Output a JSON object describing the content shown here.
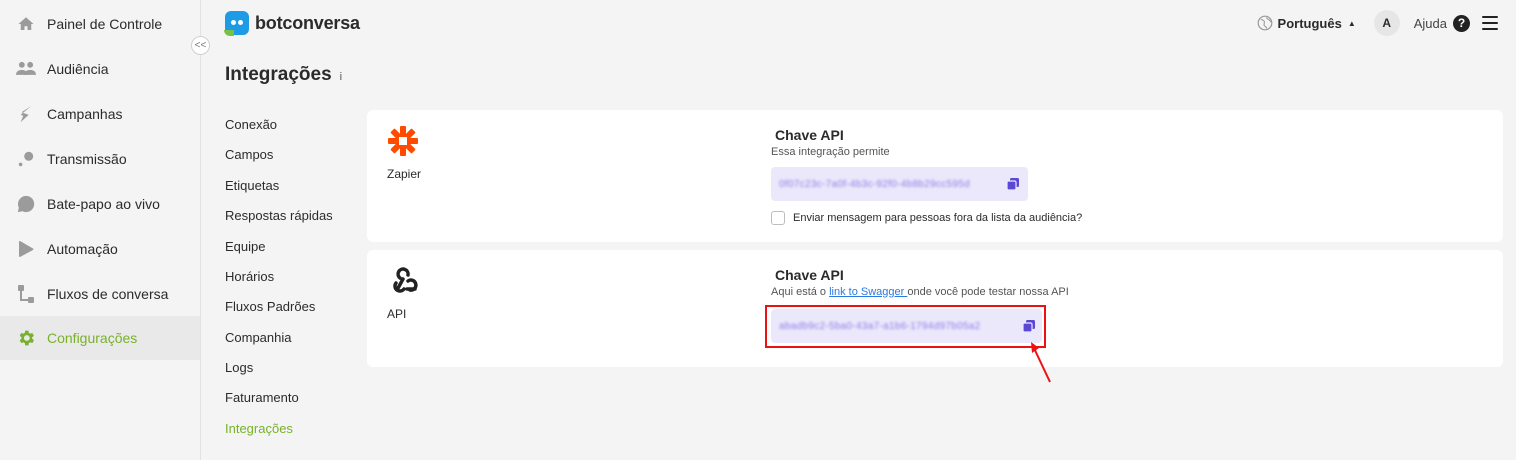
{
  "sidebar": {
    "items": [
      {
        "label": "Painel de Controle",
        "icon": "home-icon"
      },
      {
        "label": "Audiência",
        "icon": "users-icon"
      },
      {
        "label": "Campanhas",
        "icon": "campaign-icon"
      },
      {
        "label": "Transmissão",
        "icon": "broadcast-icon"
      },
      {
        "label": "Bate-papo ao vivo",
        "icon": "chat-bubble-icon"
      },
      {
        "label": "Automação",
        "icon": "play-icon"
      },
      {
        "label": "Fluxos de conversa",
        "icon": "flow-icon"
      },
      {
        "label": "Configurações",
        "icon": "gear-icon"
      }
    ],
    "collapse_label": "<<",
    "accent": "#79b12d"
  },
  "header": {
    "brand": "botconversa",
    "language": "Português",
    "avatar_initial": "A",
    "help_label": "Ajuda",
    "help_icon_label": "?"
  },
  "page": {
    "title": "Integrações",
    "info_icon_label": "i"
  },
  "settings_nav": {
    "items": [
      "Conexão",
      "Campos",
      "Etiquetas",
      "Respostas rápidas",
      "Equipe",
      "Horários",
      "Fluxos Padrões",
      "Companhia",
      "Logs",
      "Faturamento",
      "Integrações"
    ]
  },
  "zapier_card": {
    "name": "Zapier",
    "api_title": "Chave API",
    "description": "Essa integração permite",
    "key_value": "0f07c23c-7a0f-4b3c-92f0-4b8b29cc595d",
    "checkbox_label": "Enviar mensagem para pessoas fora da lista da audiência?"
  },
  "api_card": {
    "name": "API",
    "api_title": "Chave API",
    "desc_prefix": "Aqui está o ",
    "link_text": "link to Swagger ",
    "desc_suffix": "onde você pode testar nossa API",
    "key_value": "abadb9c2-5ba0-43a7-a1b6-1794d97b05a2"
  }
}
